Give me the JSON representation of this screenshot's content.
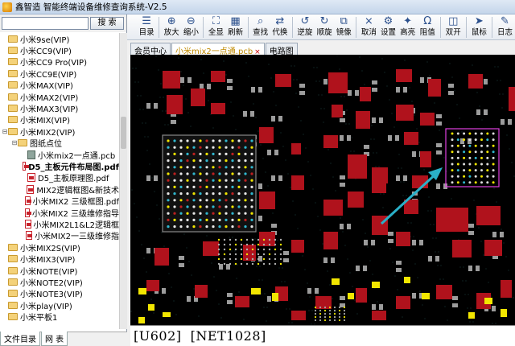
{
  "window": {
    "title": "鑫智造 智能终端设备维修查询系统-V2.5"
  },
  "toolbar": {
    "buttons": [
      {
        "label": "目录",
        "icon": "catalog-icon"
      },
      {
        "label": "放大",
        "icon": "zoom-in-icon"
      },
      {
        "label": "缩小",
        "icon": "zoom-out-icon"
      },
      {
        "label": "全显",
        "icon": "fit-all-icon"
      },
      {
        "label": "刷新",
        "icon": "refresh-icon"
      },
      {
        "label": "查找",
        "icon": "find-icon"
      },
      {
        "label": "代换",
        "icon": "replace-icon"
      },
      {
        "label": "逆旋",
        "icon": "rotate-ccw-icon"
      },
      {
        "label": "顺旋",
        "icon": "rotate-cw-icon"
      },
      {
        "label": "镜像",
        "icon": "mirror-icon"
      },
      {
        "label": "取消",
        "icon": "cancel-icon"
      },
      {
        "label": "设置",
        "icon": "settings-icon"
      },
      {
        "label": "高亮",
        "icon": "highlight-icon"
      },
      {
        "label": "阻值",
        "icon": "resistance-icon"
      },
      {
        "label": "双开",
        "icon": "dual-open-icon"
      },
      {
        "label": "鼠标",
        "icon": "mouse-icon"
      },
      {
        "label": "日志",
        "icon": "log-icon"
      }
    ]
  },
  "search": {
    "value": "",
    "button_label": "搜  索"
  },
  "tree": {
    "items": [
      {
        "label": "小米9se(VIP)",
        "type": "folder",
        "level": 0
      },
      {
        "label": "小米CC9(VIP)",
        "type": "folder",
        "level": 0
      },
      {
        "label": "小米CC9 Pro(VIP)",
        "type": "folder",
        "level": 0
      },
      {
        "label": "小米CC9E(VIP)",
        "type": "folder",
        "level": 0
      },
      {
        "label": "小米MAX(VIP)",
        "type": "folder",
        "level": 0
      },
      {
        "label": "小米MAX2(VIP)",
        "type": "folder",
        "level": 0
      },
      {
        "label": "小米MAX3(VIP)",
        "type": "folder",
        "level": 0
      },
      {
        "label": "小米MIX(VIP)",
        "type": "folder",
        "level": 0
      },
      {
        "label": "小米MIX2(VIP)",
        "type": "folder",
        "level": 0,
        "expanded": true
      },
      {
        "label": "图纸点位",
        "type": "folder",
        "level": 1,
        "expanded": true
      },
      {
        "label": "小米mix2一点通.pcb",
        "type": "pcb",
        "level": 2
      },
      {
        "label": "D5_主板元件布局图.pdf",
        "type": "pdf",
        "level": 2,
        "selected": true
      },
      {
        "label": "D5_主板原理图.pdf",
        "type": "pdf",
        "level": 2
      },
      {
        "label": "MIX2逻辑框图&新技术",
        "type": "pdf",
        "level": 2
      },
      {
        "label": "小米MIX2 三级框图.pdf",
        "type": "pdf",
        "level": 2
      },
      {
        "label": "小米MIX2 三级维修指导",
        "type": "pdf",
        "level": 2
      },
      {
        "label": "小米MIX2L1&L2逻辑框",
        "type": "pdf",
        "level": 2
      },
      {
        "label": "小米MIX2一三级维修指",
        "type": "pdf",
        "level": 2
      },
      {
        "label": "小米MIX2S(VIP)",
        "type": "folder",
        "level": 0
      },
      {
        "label": "小米MIX3(VIP)",
        "type": "folder",
        "level": 0
      },
      {
        "label": "小米NOTE(VIP)",
        "type": "folder",
        "level": 0
      },
      {
        "label": "小米NOTE2(VIP)",
        "type": "folder",
        "level": 0
      },
      {
        "label": "小米NOTE3(VIP)",
        "type": "folder",
        "level": 0
      },
      {
        "label": "小米play(VIP)",
        "type": "folder",
        "level": 0
      },
      {
        "label": "小米平板1",
        "type": "folder",
        "level": 0
      }
    ]
  },
  "left_tabs": [
    "文件目录",
    "网  表"
  ],
  "doc_tabs": [
    {
      "label": "会员中心",
      "active": false,
      "closable": false
    },
    {
      "label": "小米mix2一点通.pcb",
      "active": true,
      "closable": true
    },
    {
      "label": "电路图",
      "active": false,
      "closable": false
    }
  ],
  "status": {
    "text": "[U602]  [NET1028]"
  },
  "colors": {
    "pcb_background": "#000000",
    "component_red": "#b0121c",
    "pad_gray": "#9c9c9c",
    "pad_yellow": "#f2e600",
    "highlight_box": "#e040e0",
    "arrow": "#2ab0c8"
  }
}
